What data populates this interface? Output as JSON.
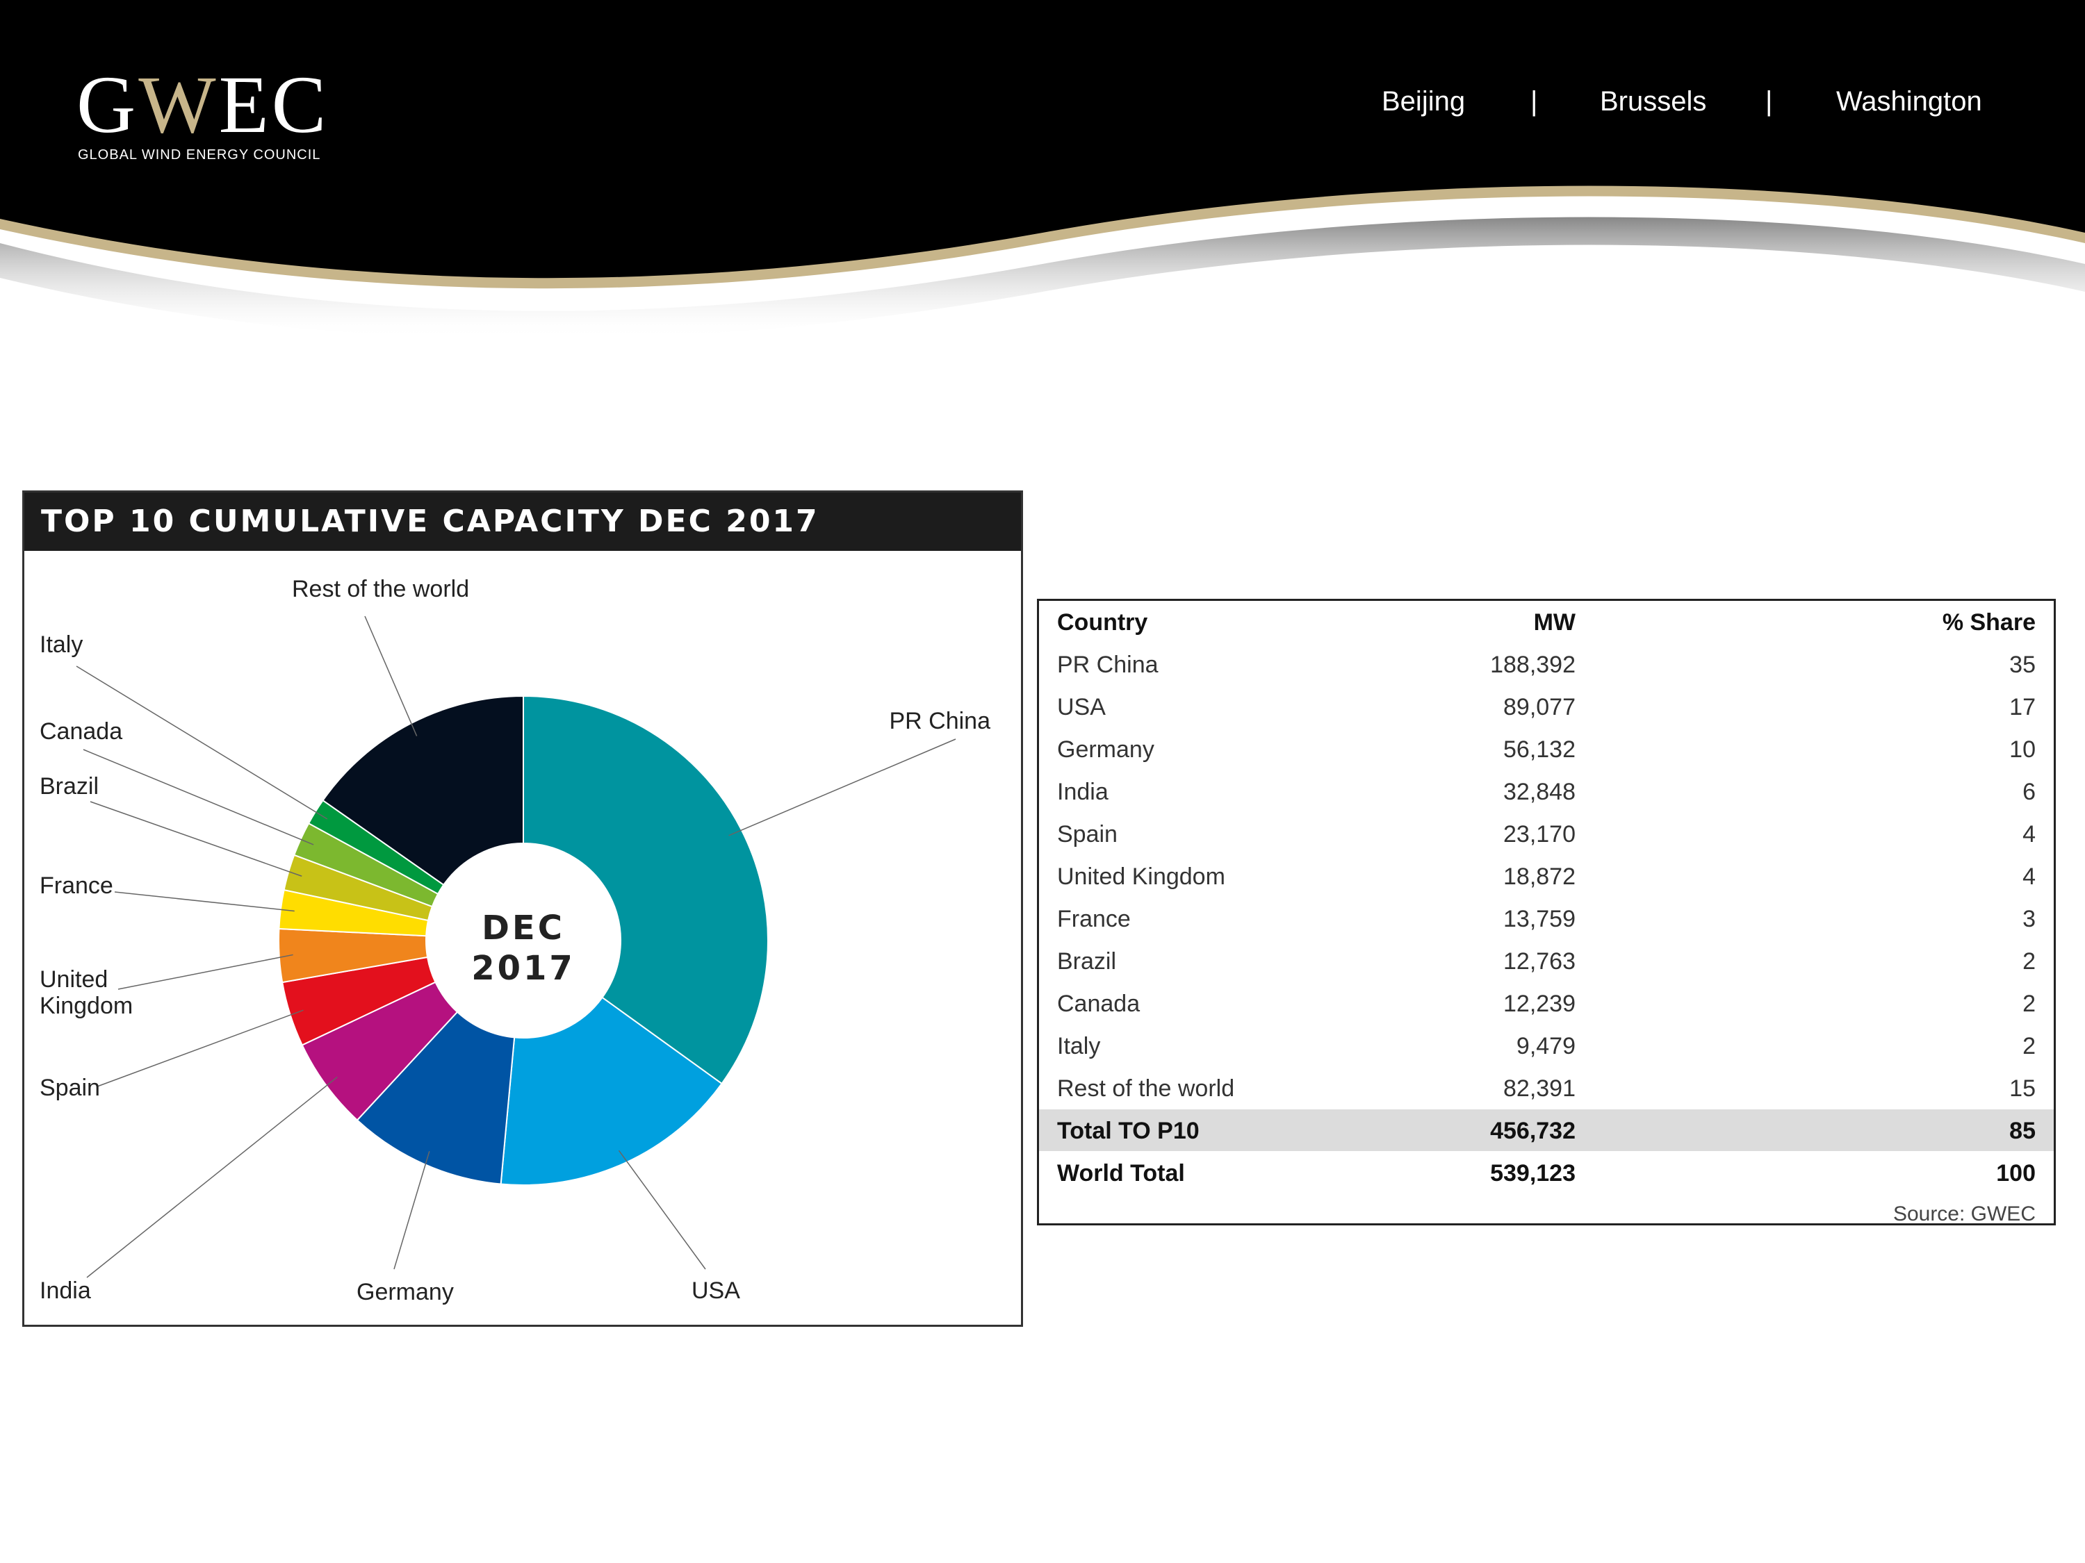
{
  "header": {
    "logo_text": "GWEC",
    "logo_subtitle": "GLOBAL WIND ENERGY COUNCIL",
    "offices": [
      "Beijing",
      "Brussels",
      "Washington"
    ],
    "separator": "|"
  },
  "colors": {
    "header_bg": "#000000",
    "swoosh_gold": "#c7b58a",
    "title_bar": "#1c1c1c"
  },
  "chart_data": {
    "type": "pie",
    "title": "TOP 10 CUMULATIVE CAPACITY DEC 2017",
    "center_label": [
      "DEC",
      "2017"
    ],
    "donut": true,
    "categories": [
      "PR China",
      "USA",
      "Germany",
      "India",
      "Spain",
      "United Kingdom",
      "France",
      "Brazil",
      "Canada",
      "Italy",
      "Rest of the world"
    ],
    "values": [
      188392,
      89077,
      56132,
      32848,
      23170,
      18872,
      13759,
      12763,
      12239,
      9479,
      82391
    ],
    "colors": [
      "#00949f",
      "#00a0df",
      "#0054a4",
      "#b5117f",
      "#e3101d",
      "#f0851c",
      "#ffdd00",
      "#c8c217",
      "#7cb82f",
      "#00993f",
      "#040f1f"
    ],
    "labels": [
      "PR China",
      "USA",
      "Germany",
      "India",
      "Spain",
      "United\nKingdom",
      "France",
      "Brazil",
      "Canada",
      "Italy",
      "Rest of the world"
    ]
  },
  "table": {
    "headers": [
      "Country",
      "MW",
      "% Share"
    ],
    "rows": [
      [
        "PR China",
        "188,392",
        "35"
      ],
      [
        "USA",
        "89,077",
        "17"
      ],
      [
        "Germany",
        "56,132",
        "10"
      ],
      [
        "India",
        "32,848",
        "6"
      ],
      [
        "Spain",
        "23,170",
        "4"
      ],
      [
        "United Kingdom",
        "18,872",
        "4"
      ],
      [
        "France",
        "13,759",
        "3"
      ],
      [
        "Brazil",
        "12,763",
        "2"
      ],
      [
        "Canada",
        "12,239",
        "2"
      ],
      [
        "Italy",
        "9,479",
        "2"
      ],
      [
        "Rest of the world",
        "82,391",
        "15"
      ]
    ],
    "total_row": [
      "Total TO P10",
      "456,732",
      "85"
    ],
    "world_row": [
      "World Total",
      "539,123",
      "100"
    ],
    "source": "Source: GWEC"
  }
}
